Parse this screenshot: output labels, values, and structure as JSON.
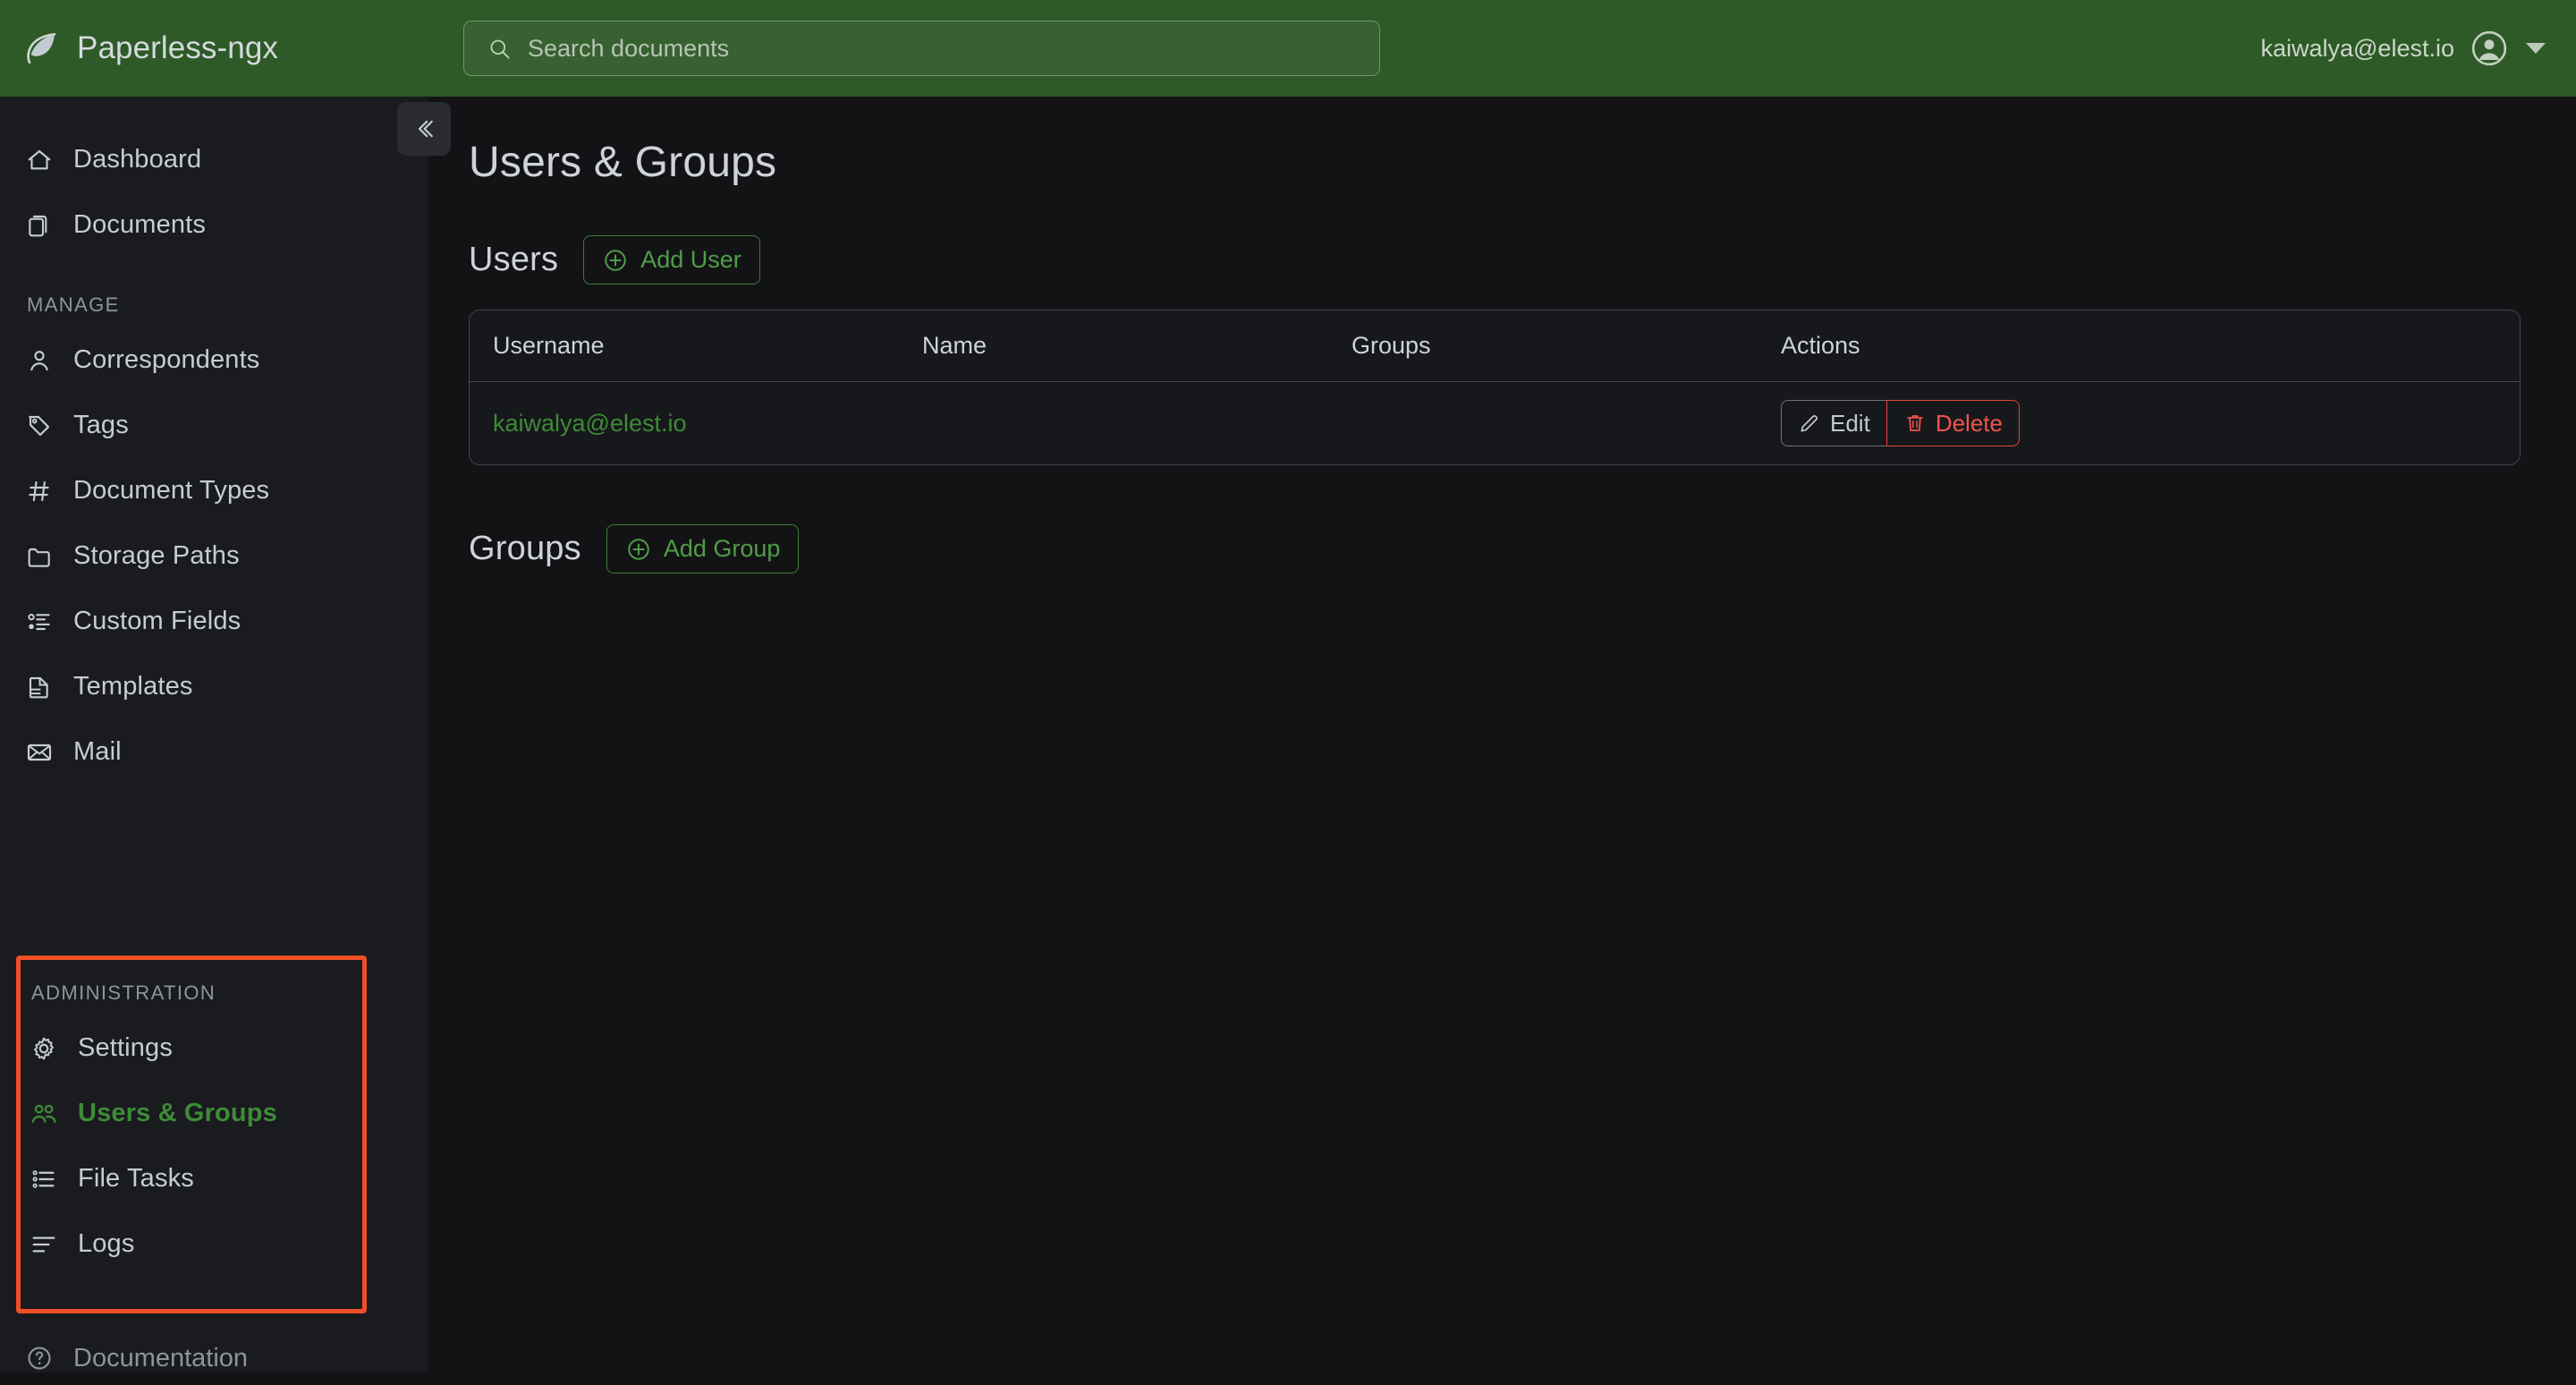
{
  "app": {
    "brand": "Paperless-ngx",
    "logo_icon": "leaf-icon"
  },
  "header": {
    "search": {
      "placeholder": "Search documents",
      "value": "",
      "icon": "search-icon"
    },
    "user_email": "kaiwalya@elest.io",
    "avatar_icon": "account-circle-icon",
    "caret_icon": "caret-down-icon"
  },
  "sidebar": {
    "collapse_icon": "chevron-double-left-icon",
    "primary_items": [
      {
        "label": "Dashboard",
        "icon": "house-icon",
        "active": false
      },
      {
        "label": "Documents",
        "icon": "files-icon",
        "active": false
      }
    ],
    "manage_label": "MANAGE",
    "manage_items": [
      {
        "label": "Correspondents",
        "icon": "person-icon",
        "active": false
      },
      {
        "label": "Tags",
        "icon": "tag-icon",
        "active": false
      },
      {
        "label": "Document Types",
        "icon": "hash-icon",
        "active": false
      },
      {
        "label": "Storage Paths",
        "icon": "folder-icon",
        "active": false
      },
      {
        "label": "Custom Fields",
        "icon": "list-detail-icon",
        "active": false
      },
      {
        "label": "Templates",
        "icon": "file-earmark-icon",
        "active": false
      },
      {
        "label": "Mail",
        "icon": "envelope-icon",
        "active": false
      }
    ],
    "administration_label": "ADMINISTRATION",
    "administration_items": [
      {
        "label": "Settings",
        "icon": "gear-icon",
        "active": false
      },
      {
        "label": "Users & Groups",
        "icon": "people-icon",
        "active": true
      },
      {
        "label": "File Tasks",
        "icon": "task-list-icon",
        "active": false
      },
      {
        "label": "Logs",
        "icon": "log-lines-icon",
        "active": false
      }
    ],
    "documentation": {
      "label": "Documentation",
      "icon": "question-circle-icon"
    },
    "highlight_color": "#ee4f26"
  },
  "main": {
    "page_title": "Users & Groups",
    "users": {
      "section_title": "Users",
      "add_button": {
        "label": "Add User",
        "icon": "plus-circle-icon"
      },
      "columns": [
        "Username",
        "Name",
        "Groups",
        "Actions"
      ],
      "rows": [
        {
          "username": "kaiwalya@elest.io",
          "name": "",
          "groups": "",
          "actions": [
            {
              "label": "Edit",
              "icon": "pencil-icon",
              "style": "neutral"
            },
            {
              "label": "Delete",
              "icon": "trash-icon",
              "style": "danger"
            }
          ]
        }
      ]
    },
    "groups": {
      "section_title": "Groups",
      "add_button": {
        "label": "Add Group",
        "icon": "plus-circle-icon"
      }
    }
  },
  "colors": {
    "header_green": "#2e5a27",
    "accent_green": "#3d8b37",
    "danger_red": "#f0544b",
    "highlight_orange": "#ee4f26",
    "sidebar_bg": "#1a1b1f",
    "content_bg": "#131316"
  }
}
